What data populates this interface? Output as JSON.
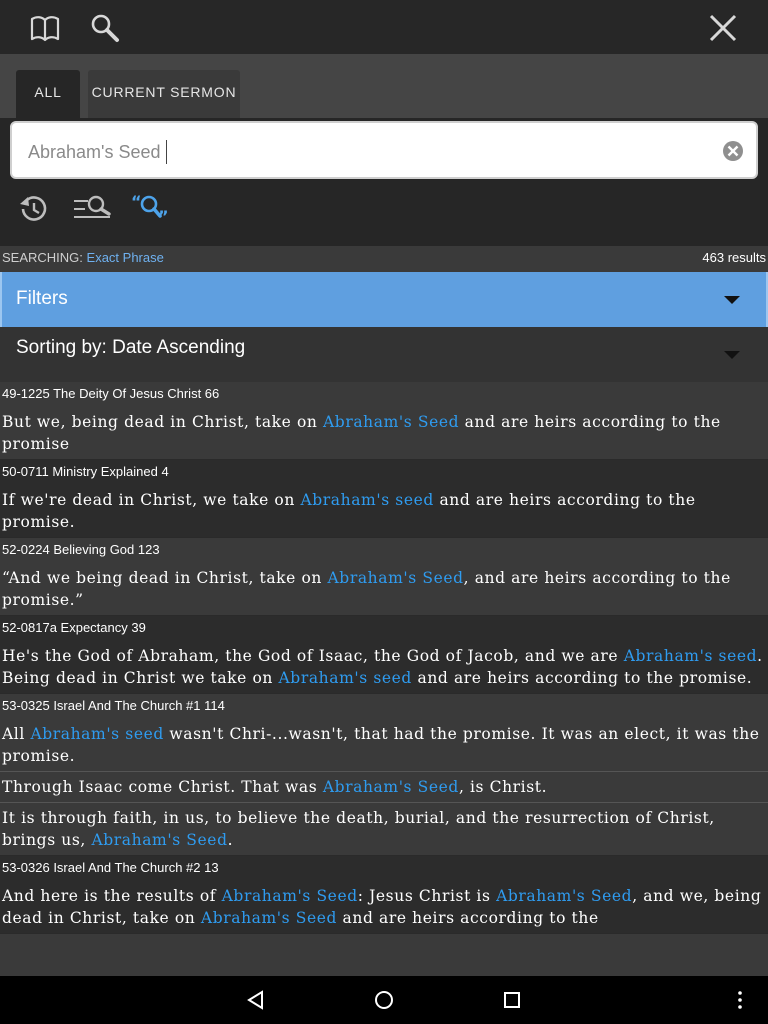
{
  "topbar": {
    "icons": [
      "book-icon",
      "search-icon",
      "close-icon"
    ]
  },
  "tabs": [
    {
      "label": "ALL",
      "active": true
    },
    {
      "label": "CURRENT SERMON",
      "active": false
    }
  ],
  "search": {
    "value": "Abraham's Seed",
    "clear_icon": "clear-circle-icon"
  },
  "tools": [
    "history-icon",
    "search-options-icon",
    "exact-phrase-search-icon"
  ],
  "status": {
    "searching_label": "SEARCHING:",
    "mode": "Exact Phrase",
    "results_count": "463 results"
  },
  "filters": {
    "label": "Filters"
  },
  "sorting": {
    "label": "Sorting by: Date Ascending"
  },
  "colors": {
    "accent": "#5f9fe0",
    "highlight": "#2f9cf0",
    "background": "#3a3a3a"
  },
  "results": [
    {
      "ref": "49-1225 The Deity Of Jesus Christ 66",
      "paragraphs": [
        [
          {
            "t": "But we, being dead in Christ, take on "
          },
          {
            "t": "Abraham's Seed",
            "h": true
          },
          {
            "t": " and are heirs according to the promise"
          }
        ]
      ]
    },
    {
      "ref": "50-0711 Ministry Explained 4",
      "paragraphs": [
        [
          {
            "t": "If we're dead in Christ, we take on "
          },
          {
            "t": "Abraham's seed",
            "h": true
          },
          {
            "t": " and are heirs according to the promise."
          }
        ]
      ]
    },
    {
      "ref": "52-0224 Believing God 123",
      "paragraphs": [
        [
          {
            "t": "“And we being dead in Christ, take on "
          },
          {
            "t": "Abraham's Seed",
            "h": true
          },
          {
            "t": ", and are heirs according to the promise.”"
          }
        ]
      ]
    },
    {
      "ref": "52-0817a Expectancy 39",
      "paragraphs": [
        [
          {
            "t": "He's the God of Abraham, the God of Isaac, the God of Jacob, and we are "
          },
          {
            "t": "Abraham's seed",
            "h": true
          },
          {
            "t": ". Being dead in Christ we take on "
          },
          {
            "t": "Abraham's seed",
            "h": true
          },
          {
            "t": " and are heirs according to the promise."
          }
        ]
      ]
    },
    {
      "ref": "53-0325 Israel And The Church #1 114",
      "paragraphs": [
        [
          {
            "t": "All "
          },
          {
            "t": "Abraham's seed",
            "h": true
          },
          {
            "t": " wasn't Chri-...wasn't, that had the promise. It was an elect, it was the promise."
          }
        ],
        [
          {
            "t": "Through Isaac come Christ. That was "
          },
          {
            "t": "Abraham's Seed",
            "h": true
          },
          {
            "t": ", is Christ."
          }
        ],
        [
          {
            "t": "It is through faith, in us, to believe the death, burial, and the resurrection of Christ, brings us, "
          },
          {
            "t": "Abraham's Seed",
            "h": true
          },
          {
            "t": "."
          }
        ]
      ]
    },
    {
      "ref": "53-0326 Israel And The Church #2 13",
      "paragraphs": [
        [
          {
            "t": "And here is the results of "
          },
          {
            "t": "Abraham's Seed",
            "h": true
          },
          {
            "t": ": Jesus Christ is "
          },
          {
            "t": "Abraham's Seed",
            "h": true
          },
          {
            "t": ", and we, being dead in Christ, take on "
          },
          {
            "t": "Abraham's Seed",
            "h": true
          },
          {
            "t": " and are heirs according to the"
          }
        ]
      ]
    }
  ],
  "navbar": [
    "back-icon",
    "home-icon",
    "recents-icon",
    "overflow-menu-icon"
  ]
}
